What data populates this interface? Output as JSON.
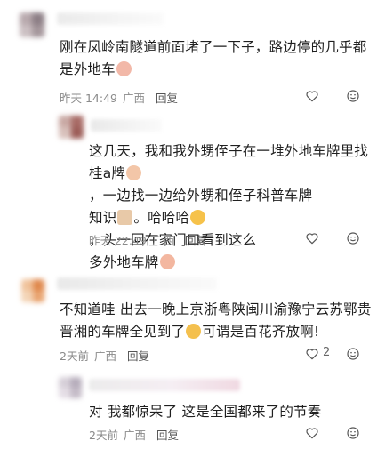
{
  "comments": [
    {
      "text_lines": [
        "刚在凤岭南隧道前面堵了一下子，路边停的几乎都",
        "是外地车"
      ],
      "date": "昨天 14:49",
      "location": "广西",
      "reply_label": "回复",
      "likes": ""
    },
    {
      "text_lines": [
        "这几天，我和我外甥侄子在一堆外地车牌里找",
        "桂a牌",
        "，一边找一边给外甥和侄子科普车牌",
        "知识",
        "。哈哈哈",
        "，头一回在家门口看到这么",
        "多外地车牌"
      ],
      "date": "昨天 22:49",
      "location": "广西",
      "reply_label": "回复",
      "likes": ""
    },
    {
      "text_lines": [
        "不知道哇 出去一晚上京浙粤陕闽川渝豫宁云苏鄂贵",
        "晋湘的车牌全见到了",
        "可谓是百花齐放啊!"
      ],
      "date": "2天前",
      "location": "广西",
      "reply_label": "回复",
      "likes": "2"
    },
    {
      "text_lines": [
        "对 我都惊呆了 这是全国都来了的节奏"
      ],
      "date": "2天前",
      "location": "广西",
      "reply_label": "回复",
      "likes": ""
    }
  ],
  "icons": {
    "like": "heart-outline-icon",
    "emoji_reaction": "smiley-icon"
  },
  "colors": {
    "text": "#1f1f1f",
    "meta": "#8a8a8a",
    "icon": "#555555"
  }
}
